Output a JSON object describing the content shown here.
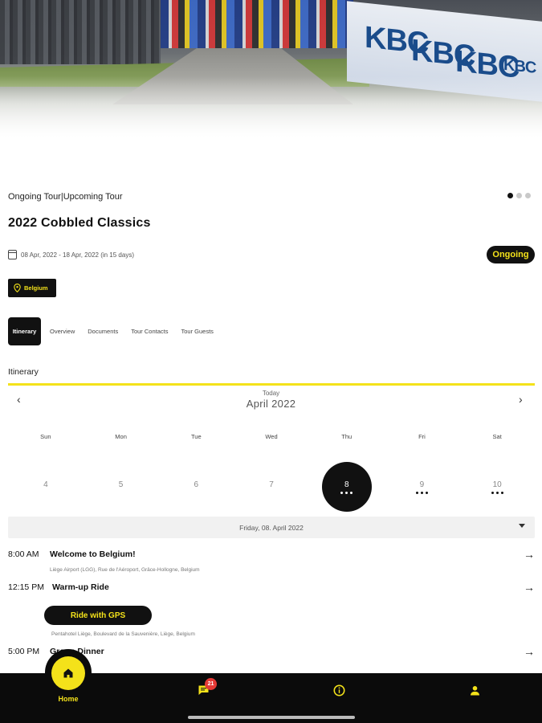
{
  "hero": {
    "banner_text": [
      "KBC",
      "KBC",
      "KBC",
      "KBC"
    ]
  },
  "tour": {
    "kind_label": "Ongoing Tour|Upcoming Tour",
    "title": "2022 Cobbled Classics",
    "dates": "08 Apr, 2022 - 18 Apr, 2022 (in 15 days)",
    "status": "Ongoing",
    "location": "Belgium",
    "carousel_page": 1,
    "carousel_total": 3
  },
  "tabs": [
    {
      "label": "Itinerary",
      "active": true
    },
    {
      "label": "Overview"
    },
    {
      "label": "Documents"
    },
    {
      "label": "Tour Contacts"
    },
    {
      "label": "Tour Guests"
    }
  ],
  "itinerary": {
    "section_title": "Itinerary",
    "today_label": "Today",
    "month": "April 2022",
    "prev": "‹",
    "next": "›",
    "weekdays": [
      "Sun",
      "Mon",
      "Tue",
      "Wed",
      "Thu",
      "Fri",
      "Sat"
    ],
    "days": [
      {
        "n": "4",
        "events": 0
      },
      {
        "n": "5",
        "events": 0
      },
      {
        "n": "6",
        "events": 0
      },
      {
        "n": "7",
        "events": 0
      },
      {
        "n": "8",
        "events": 3,
        "selected": true
      },
      {
        "n": "9",
        "events": 3
      },
      {
        "n": "10",
        "events": 3
      }
    ],
    "selected_date": "Friday, 08. April 2022",
    "events": [
      {
        "time": "8:00 AM",
        "name": "Welcome to Belgium!",
        "address": "Liège Airport (LGG), Rue de l'Aéroport, Grâce-Hollogne, Belgium"
      },
      {
        "time": "12:15 PM",
        "name": "Warm-up Ride",
        "address": "Pentahotel Liège, Boulevard de la Sauvenière, Liège, Belgium",
        "button": "Ride with GPS"
      },
      {
        "time": "5:00 PM",
        "name": "Group Dinner"
      }
    ]
  },
  "bottom_nav": {
    "home_label": "Home",
    "messages_badge": "21",
    "items": [
      "home-icon",
      "chat-icon",
      "info-icon",
      "profile-icon"
    ]
  },
  "colors": {
    "accent": "#F4E21A",
    "dark": "#111111",
    "badge": "#E53935"
  }
}
